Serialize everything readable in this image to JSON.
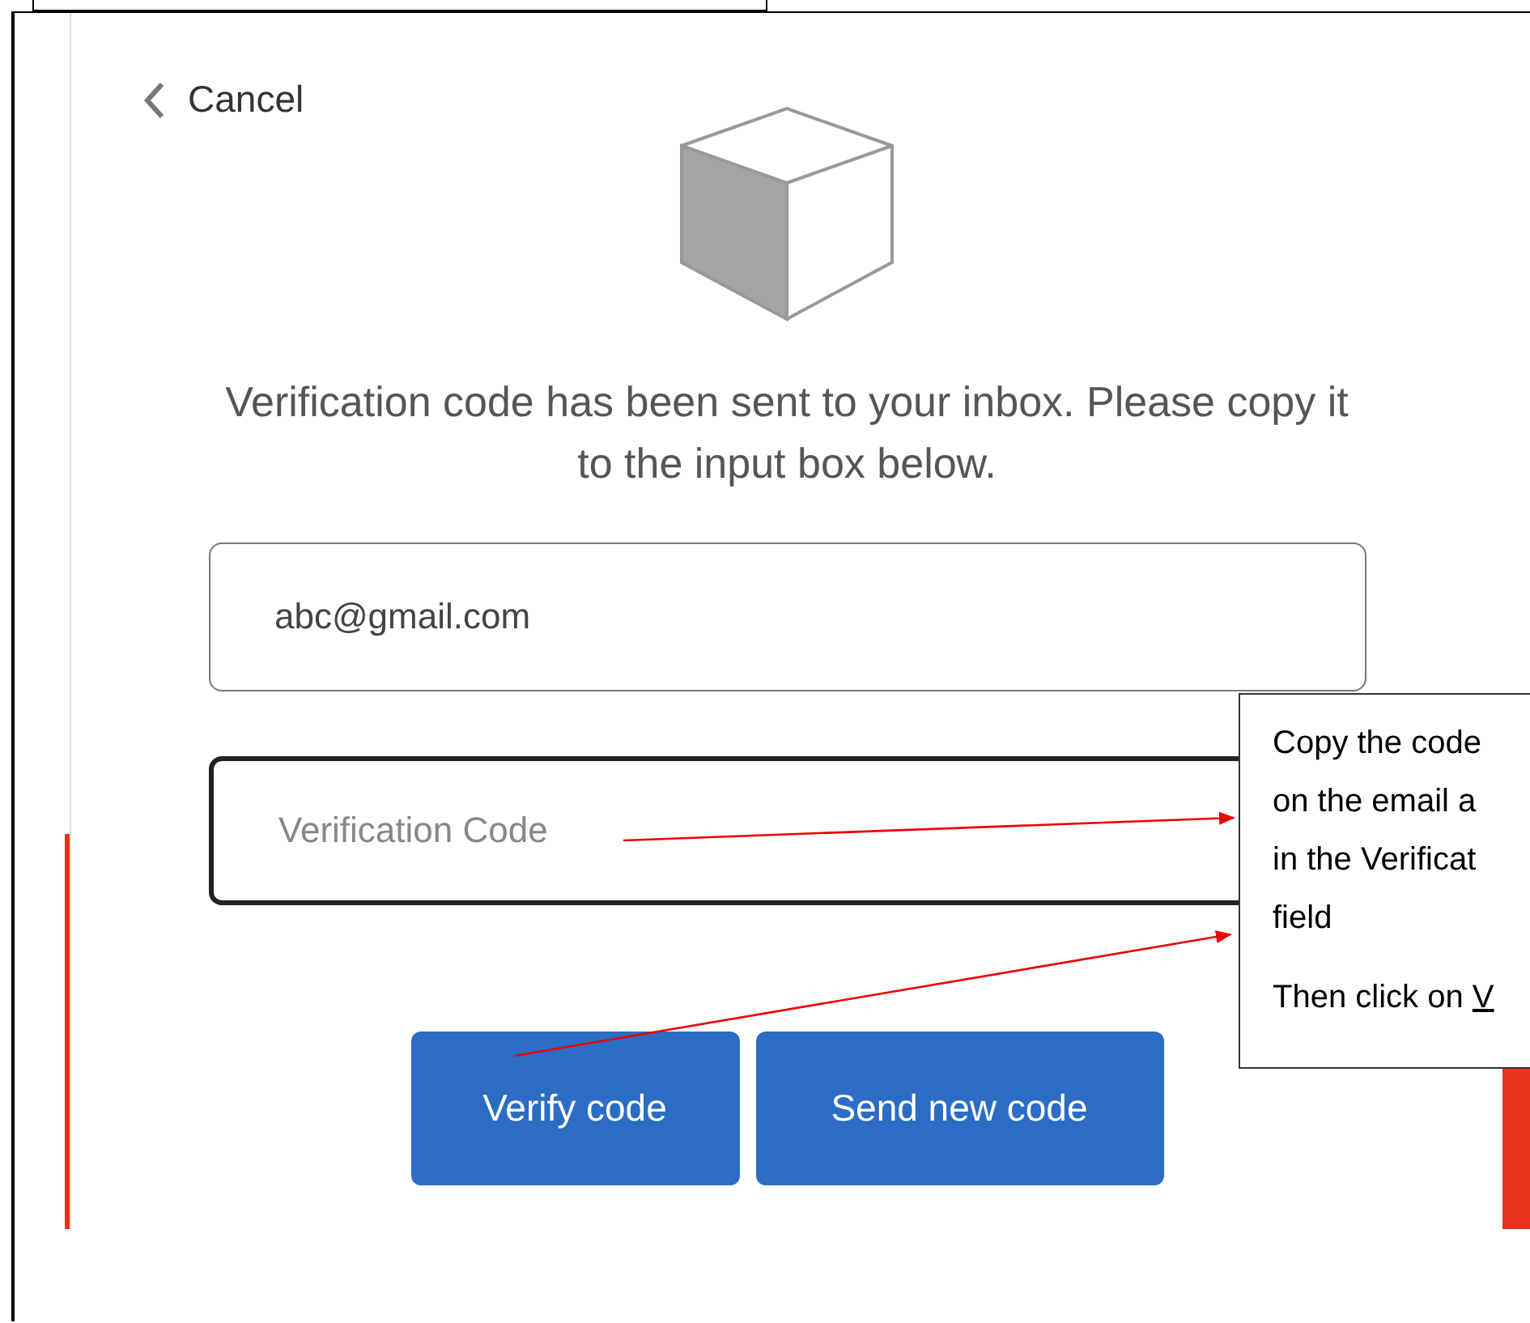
{
  "screen": {
    "cancel_link": "Cancel",
    "message": "Verification code has been sent to your inbox. Please copy it to the input box below.",
    "email_field": {
      "value": "abc@gmail.com",
      "focused": false
    },
    "code_field": {
      "placeholder": "Verification Code",
      "focused": true
    },
    "buttons": [
      "Verify code",
      "Send new code"
    ]
  },
  "callout": {
    "lines": [
      "Copy the code",
      "on the email a",
      "in the Verificat",
      "field"
    ],
    "note": "Then click on",
    "link": "V"
  }
}
